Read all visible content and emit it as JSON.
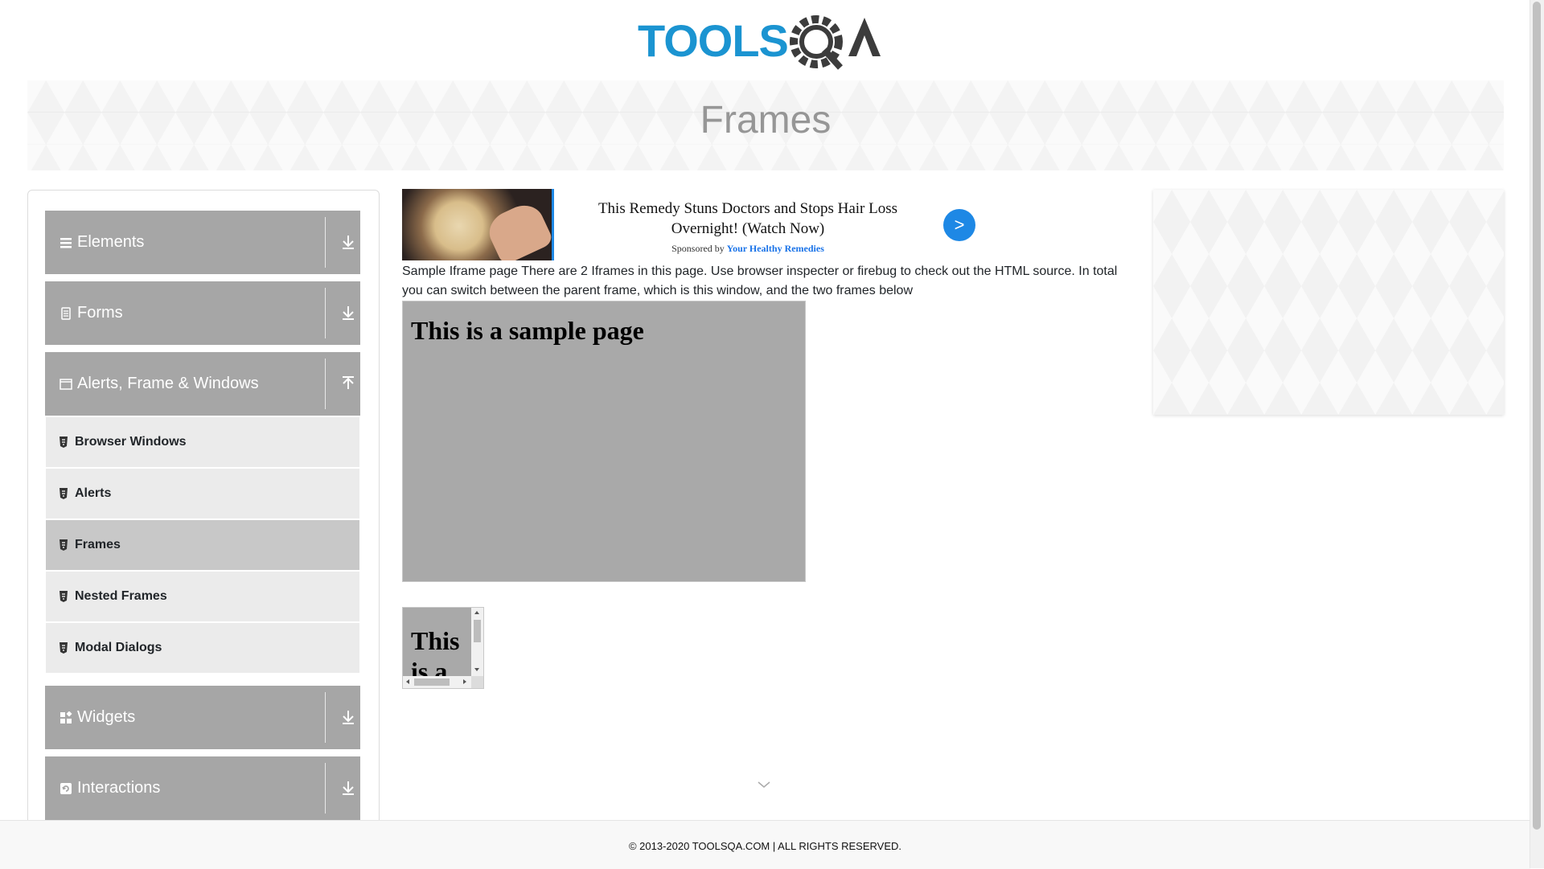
{
  "logo": {
    "text_tools": "TOOLS",
    "text_qa": "QA"
  },
  "page_title": "Frames",
  "sidebar": {
    "groups": [
      {
        "label": "Elements",
        "icon": "menu-icon",
        "arrow": "download"
      },
      {
        "label": "Forms",
        "icon": "form-icon",
        "arrow": "download"
      },
      {
        "label": "Alerts, Frame & Windows",
        "icon": "window-icon",
        "arrow": "upload"
      },
      {
        "label": "Widgets",
        "icon": "widgets-icon",
        "arrow": "download"
      },
      {
        "label": "Interactions",
        "icon": "interaction-icon",
        "arrow": "download"
      }
    ],
    "items": [
      {
        "label": "Browser Windows"
      },
      {
        "label": "Alerts"
      },
      {
        "label": "Frames"
      },
      {
        "label": "Nested Frames"
      },
      {
        "label": "Modal Dialogs"
      }
    ],
    "active_item": "Frames"
  },
  "ad": {
    "title": "This Remedy Stuns Doctors and Stops Hair Loss Overnight! (Watch Now)",
    "sponsored_prefix": "Sponsored by",
    "sponsor": "Your Healthy Remedies",
    "button": ">"
  },
  "description": "Sample Iframe page There are 2 Iframes in this page. Use browser inspecter or firebug to check out the HTML source. In total you can switch between the parent frame, which is this window, and the two frames below",
  "frame1": {
    "heading": "This is a sample page"
  },
  "frame2": {
    "heading": "This is a"
  },
  "footer": {
    "text": "© 2013-2020 TOOLSQA.COM | ALL RIGHTS RESERVED."
  },
  "colors": {
    "accent_blue": "#1e88e5",
    "logo_blue": "#1b94d1",
    "logo_dark": "#3c3c3c",
    "sidebar_group": "#a6a6a6",
    "active_item": "#c8c8c8"
  }
}
